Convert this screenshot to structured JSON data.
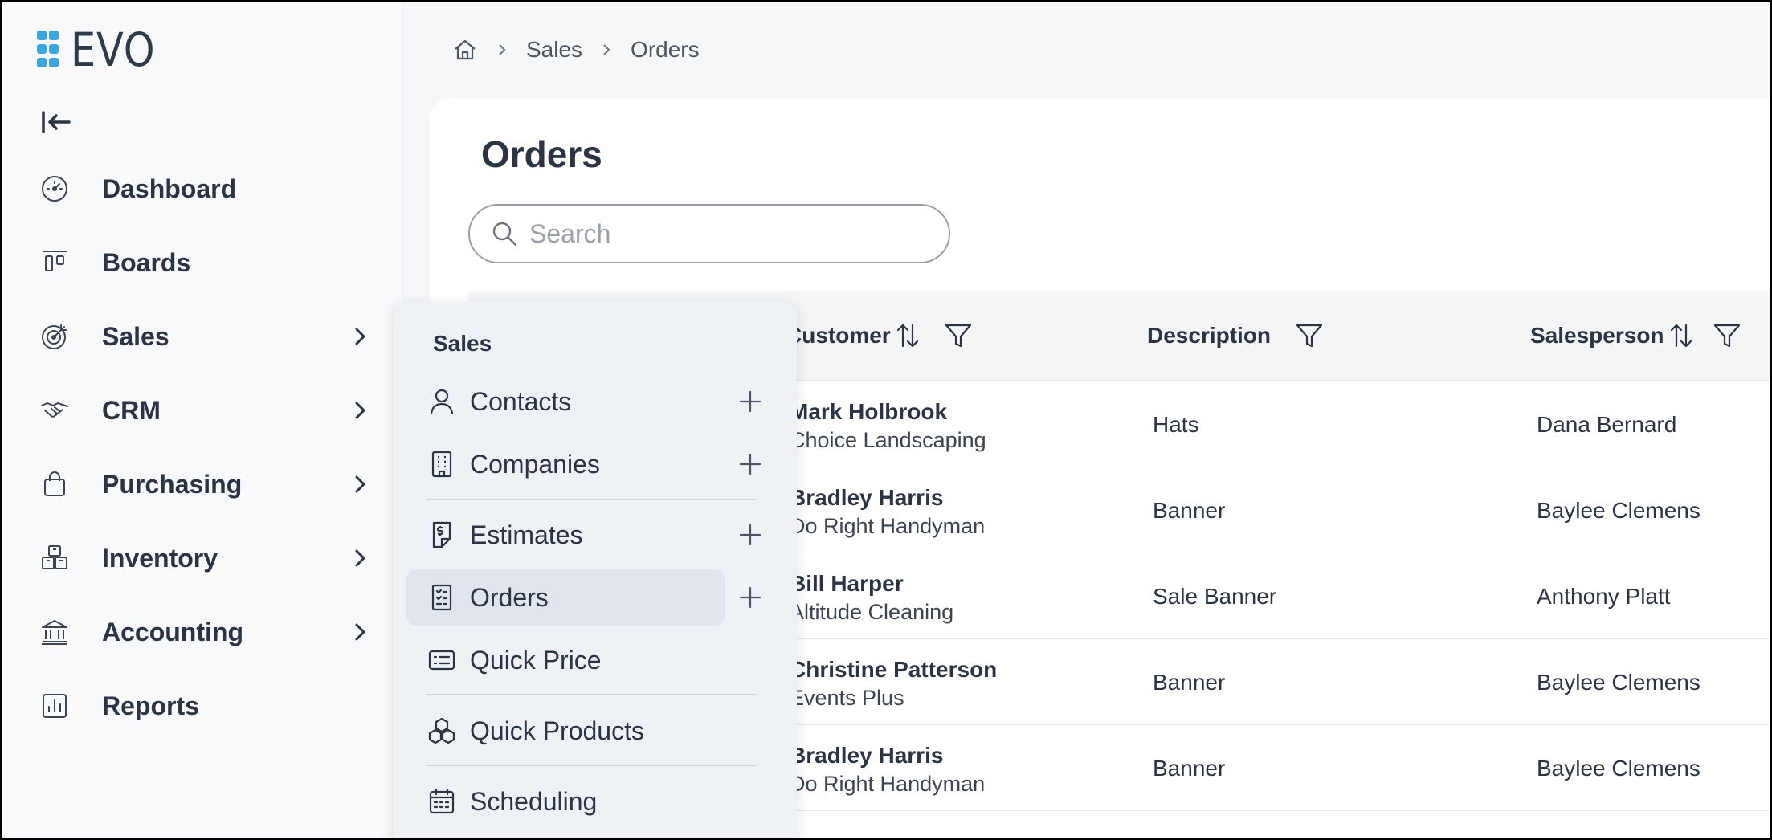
{
  "app": {
    "logo_text": "EVO"
  },
  "breadcrumb": {
    "items": [
      "Sales",
      "Orders"
    ]
  },
  "sidebar": {
    "items": [
      {
        "label": "Dashboard",
        "icon": "dashboard-icon",
        "has_submenu": false
      },
      {
        "label": "Boards",
        "icon": "boards-icon",
        "has_submenu": false
      },
      {
        "label": "Sales",
        "icon": "sales-target-icon",
        "has_submenu": true
      },
      {
        "label": "CRM",
        "icon": "handshake-icon",
        "has_submenu": true
      },
      {
        "label": "Purchasing",
        "icon": "shopping-bag-icon",
        "has_submenu": true
      },
      {
        "label": "Inventory",
        "icon": "boxes-icon",
        "has_submenu": true
      },
      {
        "label": "Accounting",
        "icon": "bank-icon",
        "has_submenu": true
      },
      {
        "label": "Reports",
        "icon": "chart-icon",
        "has_submenu": false
      }
    ]
  },
  "page": {
    "title": "Orders"
  },
  "search": {
    "placeholder": "Search",
    "value": ""
  },
  "table": {
    "columns": [
      "Customer",
      "Description",
      "Salesperson"
    ],
    "rows": [
      {
        "customer_name": "Mark Holbrook",
        "customer_company": "Choice Landscaping",
        "description": "Hats",
        "salesperson": "Dana Bernard"
      },
      {
        "customer_name": "Bradley Harris",
        "customer_company": "Do Right Handyman",
        "description": "Banner",
        "salesperson": "Baylee Clemens"
      },
      {
        "customer_name": "Bill Harper",
        "customer_company": "Altitude Cleaning",
        "description": "Sale Banner",
        "salesperson": "Anthony Platt"
      },
      {
        "customer_name": "Christine Patterson",
        "customer_company": "Events Plus",
        "description": "Banner",
        "salesperson": "Baylee Clemens"
      },
      {
        "customer_name": "Bradley Harris",
        "customer_company": "Do Right Handyman",
        "description": "Banner",
        "salesperson": "Baylee Clemens"
      }
    ]
  },
  "flyout": {
    "title": "Sales",
    "items": [
      {
        "label": "Contacts",
        "icon": "person-icon",
        "has_add": true
      },
      {
        "label": "Companies",
        "icon": "building-icon",
        "has_add": true
      },
      {
        "label": "Estimates",
        "icon": "estimate-icon",
        "has_add": true
      },
      {
        "label": "Orders",
        "icon": "checklist-icon",
        "has_add": true,
        "active": true
      },
      {
        "label": "Quick Price",
        "icon": "price-list-icon",
        "has_add": false
      },
      {
        "label": "Quick Products",
        "icon": "cubes-icon",
        "has_add": false
      },
      {
        "label": "Scheduling",
        "icon": "calendar-icon",
        "has_add": false
      }
    ]
  },
  "colors": {
    "logo_accent": "#3aa6df",
    "text_primary": "#2b3444",
    "active_bg": "#e1e6ee"
  }
}
